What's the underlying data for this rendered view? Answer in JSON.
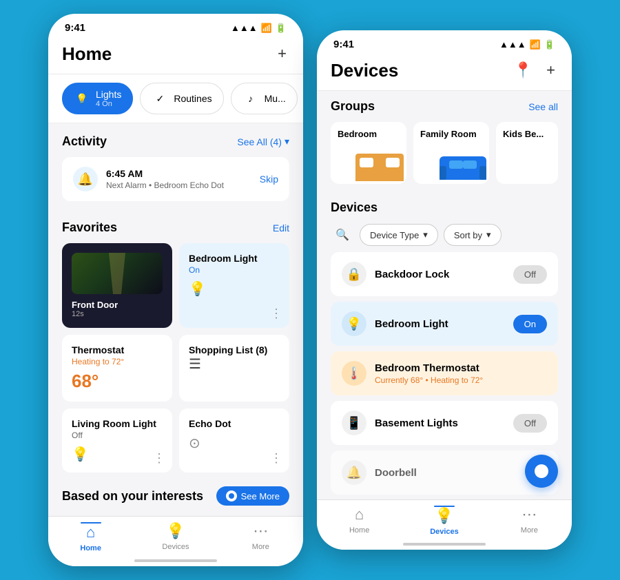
{
  "home_screen": {
    "status_time": "9:41",
    "page_title": "Home",
    "add_label": "+",
    "quick_actions": [
      {
        "id": "lights",
        "label": "Lights",
        "sublabel": "4 On",
        "active": true
      },
      {
        "id": "routines",
        "label": "Routines",
        "active": false
      },
      {
        "id": "music",
        "label": "Mu...",
        "active": false
      }
    ],
    "activity_section": {
      "title": "Activity",
      "link": "See All (4)",
      "item": {
        "time": "6:45 AM",
        "desc": "Next Alarm • Bedroom Echo Dot",
        "action": "Skip"
      }
    },
    "favorites_section": {
      "title": "Favorites",
      "edit_label": "Edit",
      "items": [
        {
          "id": "front_door",
          "title": "Front Door",
          "subtitle": "12s",
          "type": "camera"
        },
        {
          "id": "bedroom_light",
          "title": "Bedroom Light",
          "subtitle": "On",
          "type": "light_on"
        },
        {
          "id": "thermostat",
          "title": "Thermostat",
          "subtitle": "Heating to 72°",
          "value": "68°",
          "type": "thermostat"
        },
        {
          "id": "shopping_list",
          "title": "Shopping List (8)",
          "type": "list"
        },
        {
          "id": "living_room_light",
          "title": "Living Room Light",
          "subtitle": "Off",
          "type": "light_off"
        },
        {
          "id": "echo_dot",
          "title": "Echo Dot",
          "type": "echo"
        }
      ]
    },
    "interests_title": "Based on your interests",
    "see_more_label": "See More",
    "nav": [
      {
        "id": "home",
        "label": "Home",
        "active": true
      },
      {
        "id": "devices",
        "label": "Devices",
        "active": false
      },
      {
        "id": "more",
        "label": "More",
        "active": false
      }
    ]
  },
  "devices_screen": {
    "status_time": "9:41",
    "page_title": "Devices",
    "groups_section": {
      "title": "Groups",
      "see_all": "See all",
      "groups": [
        {
          "id": "bedroom",
          "name": "Bedroom"
        },
        {
          "id": "family_room",
          "name": "Family Room"
        },
        {
          "id": "kids_be",
          "name": "Kids Be..."
        }
      ]
    },
    "devices_section": {
      "title": "Devices",
      "filter_device_type": "Device Type",
      "filter_sort_by": "Sort by",
      "devices": [
        {
          "id": "backdoor_lock",
          "name": "Backdoor Lock",
          "status": "Off",
          "status_text": "",
          "type": "lock",
          "toggle": "off"
        },
        {
          "id": "bedroom_light",
          "name": "Bedroom Light",
          "status": "On",
          "status_text": "",
          "type": "light",
          "toggle": "on"
        },
        {
          "id": "bedroom_thermostat",
          "name": "Bedroom Thermostat",
          "status": "",
          "status_text": "Currently 68° • Heating to 72°",
          "type": "thermostat",
          "toggle": null
        },
        {
          "id": "basement_lights",
          "name": "Basement Lights",
          "status": "Off",
          "status_text": "",
          "type": "light_off",
          "toggle": "off"
        },
        {
          "id": "doorbell",
          "name": "Doorbell",
          "status": "",
          "status_text": "",
          "type": "doorbell",
          "toggle": null
        }
      ]
    },
    "nav": [
      {
        "id": "home",
        "label": "Home",
        "active": false
      },
      {
        "id": "devices",
        "label": "Devices",
        "active": true
      },
      {
        "id": "more",
        "label": "More",
        "active": false
      }
    ]
  },
  "colors": {
    "primary": "#1a73e8",
    "orange": "#e87722",
    "bg": "#f5f5f7",
    "white": "#ffffff",
    "light_blue_bg": "#e8f4fd",
    "warm_bg": "#fff3e0"
  }
}
